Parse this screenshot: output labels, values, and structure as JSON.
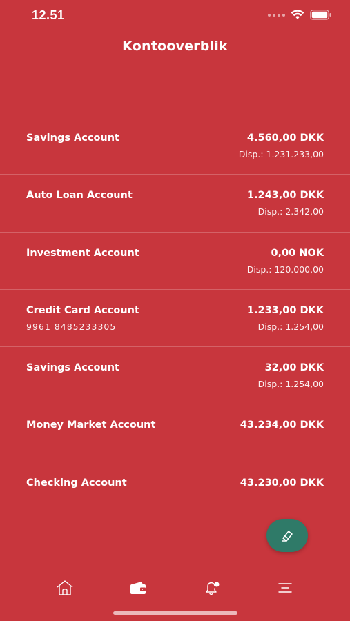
{
  "status_bar": {
    "time": "12.51"
  },
  "header": {
    "title": "Kontooverblik"
  },
  "accounts": [
    {
      "name": "Savings Account",
      "number": "",
      "amount": "4.560,00 DKK",
      "disp": "Disp.: 1.231.233,00"
    },
    {
      "name": "Auto Loan Account",
      "number": "",
      "amount": "1.243,00 DKK",
      "disp": "Disp.: 2.342,00"
    },
    {
      "name": "Investment Account",
      "number": "",
      "amount": "0,00 NOK",
      "disp": "Disp.: 120.000,00"
    },
    {
      "name": "Credit Card Account",
      "number": "9961 8485233305",
      "amount": "1.233,00 DKK",
      "disp": "Disp.: 1.254,00"
    },
    {
      "name": "Savings Account",
      "number": "",
      "amount": "32,00 DKK",
      "disp": "Disp.: 1.254,00"
    },
    {
      "name": "Money Market Account",
      "number": "",
      "amount": "43.234,00 DKK",
      "disp": ""
    },
    {
      "name": "Checking Account",
      "number": "",
      "amount": "43.230,00 DKK",
      "disp": ""
    }
  ],
  "fab": {
    "icon": "transfer-ticket-icon"
  },
  "tab_bar": {
    "items": [
      {
        "icon": "home-icon",
        "active": false
      },
      {
        "icon": "wallet-icon",
        "active": true
      },
      {
        "icon": "notifications-icon",
        "active": false
      },
      {
        "icon": "menu-icon",
        "active": false
      }
    ]
  },
  "colors": {
    "background": "#c8363d",
    "fab": "#2f7a68",
    "text": "#ffffff"
  }
}
